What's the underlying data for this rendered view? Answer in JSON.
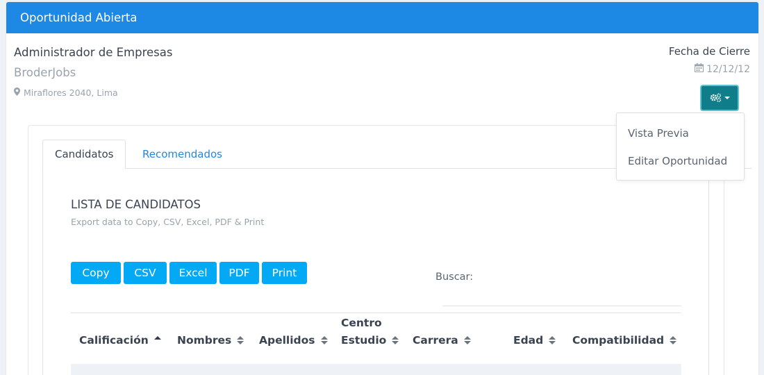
{
  "header": {
    "title": "Oportunidad Abierta"
  },
  "job": {
    "title": "Administrador de Empresas",
    "company": "BroderJobs",
    "location": "Miraflores 2040, Lima",
    "close_label": "Fecha de Cierre",
    "close_date": "12/12/12"
  },
  "actions_menu": {
    "icon": "gears-icon",
    "items": [
      {
        "label": "Vista Previa"
      },
      {
        "label": "Editar Oportunidad"
      }
    ]
  },
  "tabs": [
    {
      "label": "Candidatos",
      "active": true
    },
    {
      "label": "Recomendados",
      "active": false
    }
  ],
  "list": {
    "title": "LISTA DE CANDIDATOS",
    "subtitle": "Export data to Copy, CSV, Excel, PDF & Print",
    "export_buttons": [
      {
        "label": "Copy"
      },
      {
        "label": "CSV"
      },
      {
        "label": "Excel"
      },
      {
        "label": "PDF"
      },
      {
        "label": "Print"
      }
    ],
    "search_label": "Buscar:",
    "search_value": "",
    "columns": [
      {
        "line1": "",
        "line2": "Calificación",
        "sort": "asc"
      },
      {
        "line1": "",
        "line2": "Nombres",
        "sort": "both"
      },
      {
        "line1": "",
        "line2": "Apellidos",
        "sort": "both"
      },
      {
        "line1": "Centro",
        "line2": "Estudio",
        "sort": "both"
      },
      {
        "line1": "",
        "line2": "Carrera",
        "sort": "both"
      },
      {
        "line1": "",
        "line2": "Edad",
        "sort": "both"
      },
      {
        "line1": "",
        "line2": "Compatibilidad",
        "sort": "both"
      }
    ]
  },
  "colors": {
    "header_blue": "#1e88e5",
    "button_blue": "#03a9f4",
    "gear_button": "#0f7d8a",
    "link_blue": "#1e88e5"
  }
}
